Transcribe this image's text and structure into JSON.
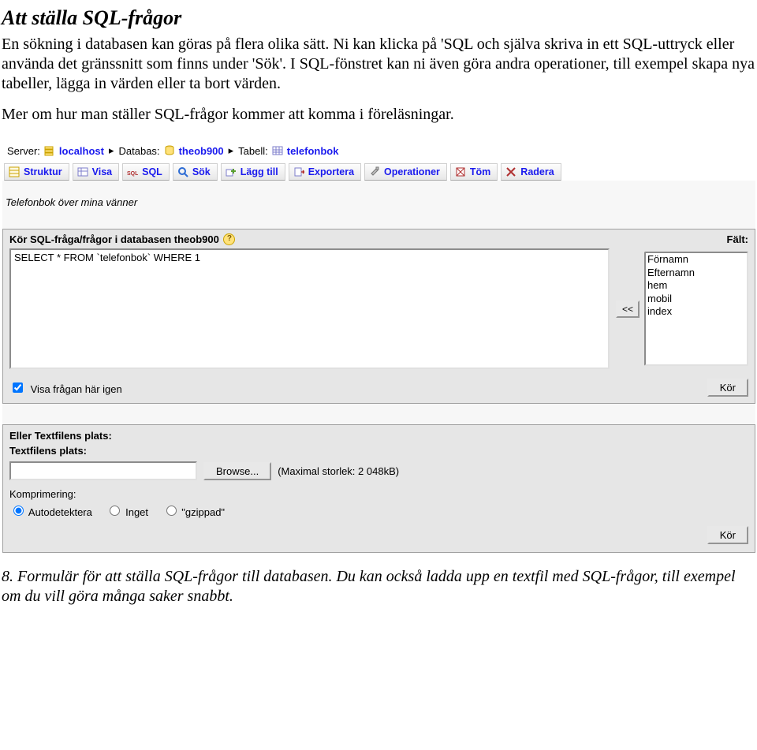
{
  "doc": {
    "heading": "Att ställa SQL-frågor",
    "para1": "En sökning i databasen kan göras på flera olika sätt. Ni kan klicka på 'SQL och själva skriva in ett SQL-uttryck eller använda det gränssnitt som finns under 'Sök'. I SQL-fönstret kan ni även göra andra operationer, till exempel skapa nya tabeller, lägga in värden eller ta bort värden.",
    "para2": "Mer om hur man ställer SQL-frågor kommer att komma i föreläsningar.",
    "caption": "8. Formulär för att ställa SQL-frågor till databasen. Du kan också ladda upp en textfil med SQL-frågor, till exempel om du vill göra många saker snabbt."
  },
  "pma": {
    "breadcrumb": {
      "server_label": "Server:",
      "server_link": "localhost",
      "database_label": "Databas:",
      "database_link": "theob900",
      "table_label": "Tabell:",
      "table_link": "telefonbok"
    },
    "tabs": {
      "struktur": "Struktur",
      "visa": "Visa",
      "sql": "SQL",
      "sok": "Sök",
      "laggtill": "Lägg till",
      "exportera": "Exportera",
      "operationer": "Operationer",
      "tom": "Töm",
      "radera": "Radera"
    },
    "comment": "Telefonbok över mina vänner",
    "sqlpanel": {
      "title": "Kör SQL-fråga/frågor i databasen theob900",
      "fields_label": "Fält:",
      "query": "SELECT * FROM `telefonbok` WHERE 1",
      "insert_btn": "<<",
      "fields": [
        "Förnamn",
        "Efternamn",
        "hem",
        "mobil",
        "index"
      ],
      "show_again_label": "Visa frågan här igen",
      "run_btn": "Kör"
    },
    "filepanel": {
      "or_label": "Eller Textfilens plats:",
      "loc_label": "Textfilens plats:",
      "browse_btn": "Browse...",
      "max_note": "(Maximal storlek: 2 048kB)",
      "compression_label": "Komprimering:",
      "radio_auto": "Autodetektera",
      "radio_none": "Inget",
      "radio_gzip": "\"gzippad\"",
      "run_btn": "Kör"
    }
  }
}
